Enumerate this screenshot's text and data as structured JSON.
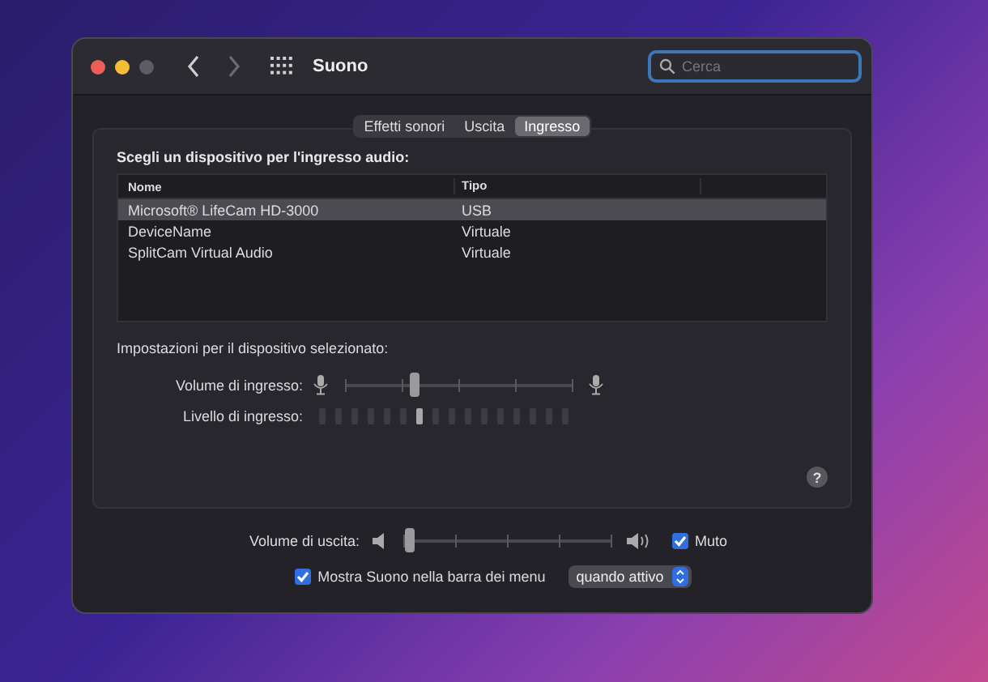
{
  "window": {
    "title": "Suono"
  },
  "search": {
    "placeholder": "Cerca"
  },
  "tabs": [
    {
      "label": "Effetti sonori",
      "selected": false
    },
    {
      "label": "Uscita",
      "selected": false
    },
    {
      "label": "Ingresso",
      "selected": true
    }
  ],
  "device_list": {
    "heading": "Scegli un dispositivo per l'ingresso audio:",
    "columns": [
      "Nome",
      "Tipo"
    ],
    "rows": [
      {
        "name": "Microsoft® LifeCam HD-3000",
        "type": "USB",
        "selected": true
      },
      {
        "name": "DeviceName",
        "type": "Virtuale",
        "selected": false
      },
      {
        "name": "SplitCam Virtual Audio",
        "type": "Virtuale",
        "selected": false
      }
    ]
  },
  "settings": {
    "heading": "Impostazioni per il dispositivo selezionato:",
    "input_volume": {
      "label": "Volume di ingresso:",
      "level": 0.31
    },
    "input_level": {
      "label": "Livello di ingresso:",
      "level": 0.4
    }
  },
  "help": {
    "label": "?"
  },
  "output_volume": {
    "label": "Volume di uscita:",
    "level": 0.03
  },
  "mute": {
    "label": "Muto",
    "checked": true
  },
  "show_in_menu": {
    "label": "Mostra Suono nella barra dei menu",
    "checked": true
  },
  "menu_option": {
    "value": "quando attivo"
  }
}
